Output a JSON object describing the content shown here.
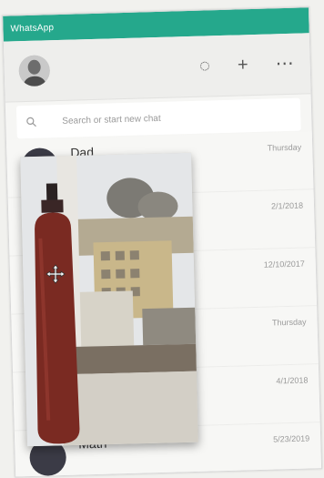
{
  "app": {
    "title": "WhatsApp",
    "accent": "#25a88c"
  },
  "header": {
    "icons": [
      "status-icon",
      "new-chat-icon",
      "menu-icon"
    ],
    "status_glyph": "◌",
    "add_glyph": "+",
    "menu_glyph": "⋯"
  },
  "search": {
    "placeholder": "Search or start new chat"
  },
  "chats": [
    {
      "name": "Dad",
      "snippet": "",
      "time": "Thursday"
    },
    {
      "name": "",
      "snippet": "",
      "time": "2/1/2018"
    },
    {
      "name": "",
      "snippet": "",
      "time": "12/10/2017"
    },
    {
      "name": "",
      "snippet": "",
      "time": "Thursday"
    },
    {
      "name": "",
      "snippet": "",
      "time": "4/1/2018"
    },
    {
      "name": "Math",
      "snippet": "",
      "time": "5/23/2019"
    }
  ]
}
